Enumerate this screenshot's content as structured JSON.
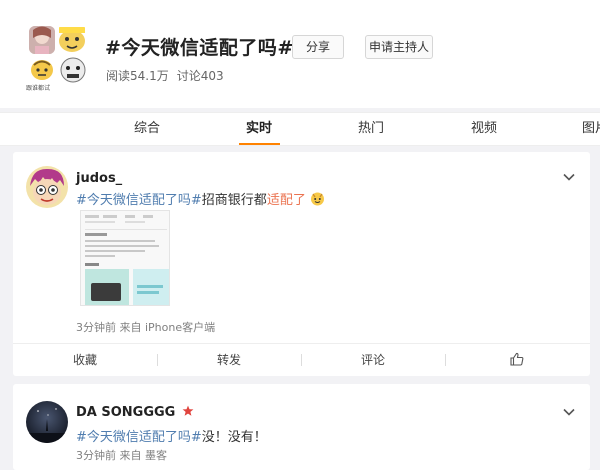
{
  "topic": {
    "title": "#今天微信适配了吗#",
    "share_label": "分享",
    "host_label": "申请主持人",
    "reads": "阅读54.1万",
    "discussions": "讨论403",
    "cover_caption": "跟谁都试"
  },
  "tabs": [
    "综合",
    "实时",
    "热门",
    "视频",
    "图片"
  ],
  "active_tab": "实时",
  "posts": [
    {
      "author": "judos_",
      "hashtag": "#今天微信适配了吗#",
      "text_before": "招商银行都",
      "highlight": "适配了",
      "emoji": "emoji-smile-icon",
      "meta": "3分钟前 来自 iPhone客户端",
      "actions": [
        "收藏",
        "转发",
        "评论"
      ]
    },
    {
      "author": "DA SONGGGG",
      "hashtag": "#今天微信适配了吗#",
      "text": "没！没有！",
      "meta": "3分钟前 来自 墨客"
    }
  ],
  "colors": {
    "accent": "#ff8200",
    "hashtag": "#eb7350",
    "link": "#507daf",
    "badge": "#e0443e"
  }
}
